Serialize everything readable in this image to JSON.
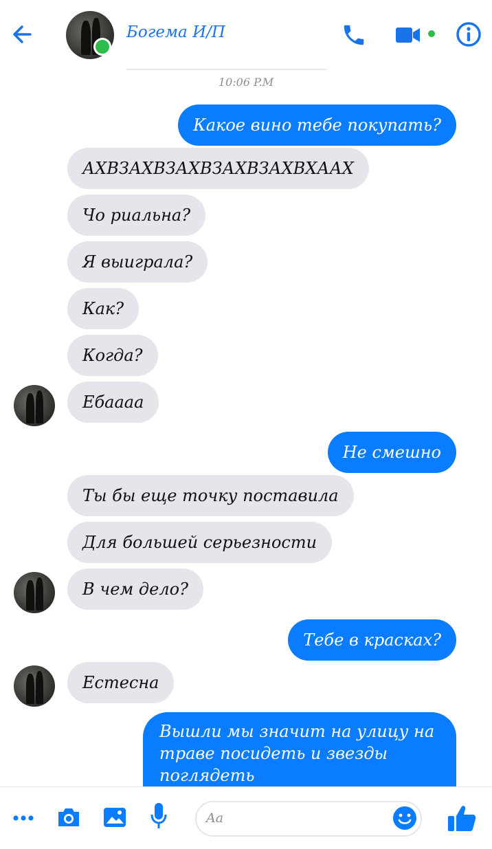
{
  "header": {
    "contact_name": "Богема И/П",
    "icons": [
      "back-arrow-icon",
      "phone-icon",
      "video-camera-icon",
      "info-icon"
    ]
  },
  "chat": {
    "timestamp": "10:06 P.M",
    "messages": [
      {
        "side": "out",
        "text": "Какое вино тебе покупать?"
      },
      {
        "side": "in",
        "text": "АХВЗАХВЗАХВЗАХВЗАХВХААХ"
      },
      {
        "side": "in",
        "text": "Чо риальна?"
      },
      {
        "side": "in",
        "text": "Я выиграла?"
      },
      {
        "side": "in",
        "text": "Как?"
      },
      {
        "side": "in",
        "text": "Когда?"
      },
      {
        "side": "in",
        "text": "Ебаааа"
      },
      {
        "side": "out",
        "text": "Не смешно"
      },
      {
        "side": "in",
        "text": "Ты бы еще точку поставила"
      },
      {
        "side": "in",
        "text": "Для большей серьезности"
      },
      {
        "side": "in",
        "text": "В чем дело?"
      },
      {
        "side": "out",
        "text": "Тебе в красках?"
      },
      {
        "side": "in",
        "text": "Естесна"
      },
      {
        "side": "out",
        "text": "Вышли мы значит на улицу на траве посидеть и звезды поглядеть"
      }
    ]
  },
  "composer": {
    "placeholder": "Aa",
    "icons": [
      "more-dots-icon",
      "camera-icon",
      "photo-icon",
      "microphone-icon",
      "emoji-icon",
      "thumbs-up-icon"
    ]
  },
  "colors": {
    "accent": "#0a7cff",
    "incoming_bubble": "#e4e6eb",
    "online": "#2ebd4c"
  }
}
